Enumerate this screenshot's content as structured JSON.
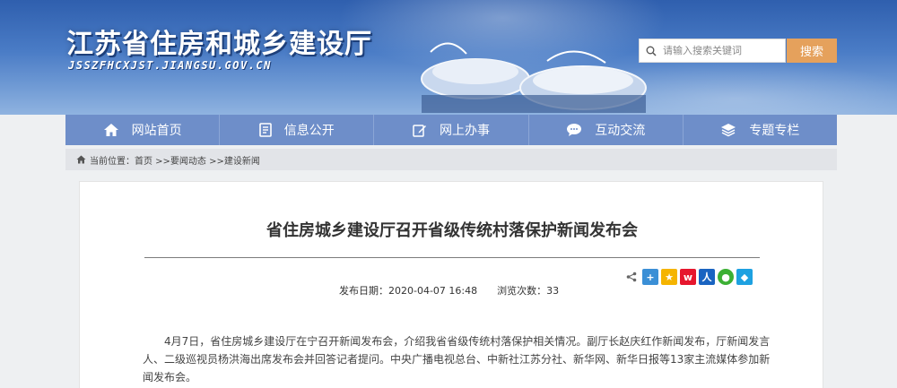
{
  "header": {
    "site_title": "江苏省住房和城乡建设厅",
    "site_url": "JSSZFHCXJST.JIANGSU.GOV.CN",
    "search_placeholder": "请输入搜索关键词",
    "search_button": "搜索"
  },
  "nav": {
    "items": [
      {
        "label": "网站首页",
        "icon": "home-icon"
      },
      {
        "label": "信息公开",
        "icon": "document-icon"
      },
      {
        "label": "网上办事",
        "icon": "edit-icon"
      },
      {
        "label": "互动交流",
        "icon": "chat-icon"
      },
      {
        "label": "专题专栏",
        "icon": "layers-icon"
      }
    ]
  },
  "breadcrumb": {
    "icon": "home-icon",
    "current": "当前位置：首页",
    "level1": " >>要闻动态",
    "level2": " >>建设新闻"
  },
  "article": {
    "title": "省住房城乡建设厅召开省级传统村落保护新闻发布会",
    "publish_label": "发布日期：2020-04-07 16:48",
    "views_label": "浏览次数：33",
    "share_icons": [
      "share-icon",
      "plus-share-icon",
      "qzone-icon",
      "weibo-icon",
      "renren-icon",
      "wechat-icon",
      "tencent-weibo-icon"
    ],
    "body": "4月7日，省住房城乡建设厅在宁召开新闻发布会，介绍我省省级传统村落保护相关情况。副厅长赵庆红作新闻发布，厅新闻发言人、二级巡视员杨洪海出席发布会并回答记者提问。中央广播电视总台、中新社江苏分社、新华网、新华日报等13家主流媒体参加新闻发布会。"
  },
  "colors": {
    "nav_bg": "#6e8ec9",
    "search_button_bg": "#e5a15c",
    "header_blue": "#2f5fae"
  }
}
